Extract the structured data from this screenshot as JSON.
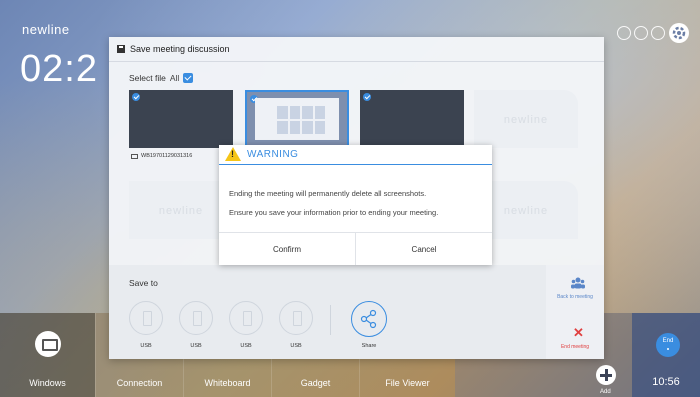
{
  "desktop": {
    "brand": "newline",
    "clock": "02:2"
  },
  "taskbar": {
    "items": [
      {
        "label": "Windows"
      },
      {
        "label": "Connection"
      },
      {
        "label": "Whiteboard"
      },
      {
        "label": "Gadget"
      },
      {
        "label": "File Viewer"
      }
    ],
    "add_label": "Add",
    "end_label": "End",
    "time": "10:56"
  },
  "dialog": {
    "title": "Save meeting discussion",
    "select_label": "Select file",
    "all_label": "All",
    "watermark": "newline",
    "thumb_caption": "WB19701129031316",
    "save_to_label": "Save to",
    "targets": [
      {
        "label": "USB"
      },
      {
        "label": "USB"
      },
      {
        "label": "USB"
      },
      {
        "label": "USB"
      }
    ],
    "share_label": "Share",
    "back_label": "Back to meeting",
    "end_label": "End meeting"
  },
  "warning": {
    "title": "WARNING",
    "line1": "Ending the meeting will permanently delete all screenshots.",
    "line2": "Ensure you save your information prior to ending your meeting.",
    "confirm_label": "Confirm",
    "cancel_label": "Cancel"
  },
  "colors": {
    "accent": "#3a8de0",
    "danger": "#e04040",
    "warning": "#f5c518"
  }
}
